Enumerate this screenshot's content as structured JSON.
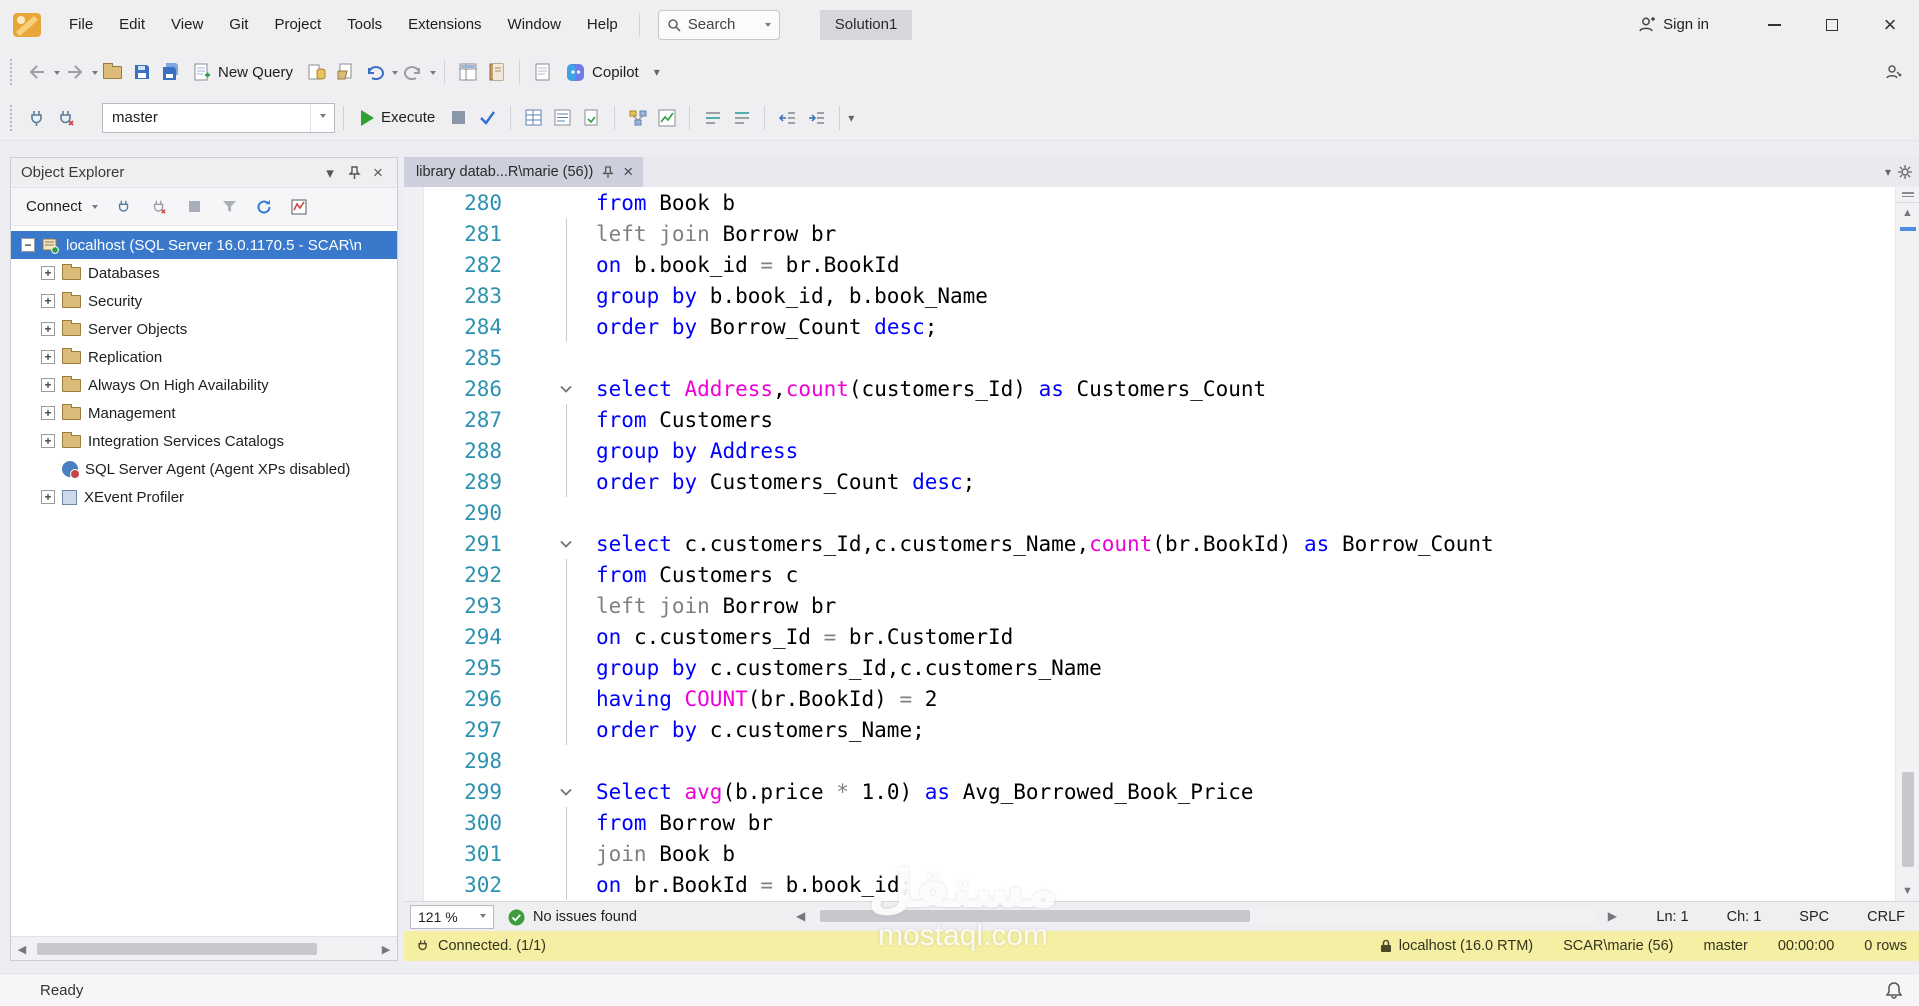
{
  "menu": {
    "items": [
      "File",
      "Edit",
      "View",
      "Git",
      "Project",
      "Tools",
      "Extensions",
      "Window",
      "Help"
    ],
    "search_label": "Search",
    "solution": "Solution1",
    "sign_in": "Sign in"
  },
  "toolbar": {
    "new_query": "New Query",
    "copilot": "Copilot"
  },
  "query_toolbar": {
    "database": "master",
    "execute": "Execute"
  },
  "object_explorer": {
    "title": "Object Explorer",
    "connect": "Connect",
    "root": "localhost (SQL Server 16.0.1170.5 - SCAR\\n",
    "items": [
      {
        "label": "Databases",
        "icon": "folder",
        "expand": true
      },
      {
        "label": "Security",
        "icon": "folder",
        "expand": true
      },
      {
        "label": "Server Objects",
        "icon": "folder",
        "expand": true
      },
      {
        "label": "Replication",
        "icon": "folder",
        "expand": true
      },
      {
        "label": "Always On High Availability",
        "icon": "folder",
        "expand": true
      },
      {
        "label": "Management",
        "icon": "folder",
        "expand": true
      },
      {
        "label": "Integration Services Catalogs",
        "icon": "folder",
        "expand": true
      },
      {
        "label": "SQL Server Agent (Agent XPs disabled)",
        "icon": "agent",
        "expand": false
      },
      {
        "label": "XEvent Profiler",
        "icon": "xevent",
        "expand": true
      }
    ]
  },
  "editor": {
    "tab_title": "library datab...R\\marie (56))",
    "zoom": "121 %",
    "issues": "No issues found",
    "ln": "Ln: 1",
    "ch": "Ch: 1",
    "spc": "SPC",
    "eol": "CRLF",
    "code": [
      {
        "n": "280",
        "seg": [
          [
            "k",
            "from"
          ],
          [
            "t",
            " Book b"
          ]
        ]
      },
      {
        "n": "281",
        "g": 1,
        "seg": [
          [
            "o",
            "left join"
          ],
          [
            "t",
            " Borrow br"
          ]
        ]
      },
      {
        "n": "282",
        "g": 1,
        "seg": [
          [
            "k",
            "on"
          ],
          [
            "t",
            " b.book_id "
          ],
          [
            "o",
            "="
          ],
          [
            "t",
            " br.BookId"
          ]
        ]
      },
      {
        "n": "283",
        "g": 1,
        "seg": [
          [
            "k",
            "group by"
          ],
          [
            "t",
            " b.book_id, b.book_Name"
          ]
        ]
      },
      {
        "n": "284",
        "g": 1,
        "seg": [
          [
            "k",
            "order by"
          ],
          [
            "t",
            " Borrow_Count "
          ],
          [
            "k",
            "desc"
          ],
          [
            "t",
            ";"
          ]
        ]
      },
      {
        "n": "285",
        "seg": []
      },
      {
        "n": "286",
        "fold": 1,
        "seg": [
          [
            "k",
            "select"
          ],
          [
            "t",
            " "
          ],
          [
            "f",
            "Address"
          ],
          [
            "t",
            ","
          ],
          [
            "f",
            "count"
          ],
          [
            "t",
            "(customers_Id) "
          ],
          [
            "k",
            "as"
          ],
          [
            "t",
            " Customers_Count"
          ]
        ]
      },
      {
        "n": "287",
        "g": 1,
        "seg": [
          [
            "k",
            "from"
          ],
          [
            "t",
            " Customers"
          ]
        ]
      },
      {
        "n": "288",
        "g": 1,
        "seg": [
          [
            "k",
            "group by"
          ],
          [
            "t",
            " "
          ],
          [
            "k",
            "Address"
          ]
        ]
      },
      {
        "n": "289",
        "g": 1,
        "seg": [
          [
            "k",
            "order by"
          ],
          [
            "t",
            " Customers_Count "
          ],
          [
            "k",
            "desc"
          ],
          [
            "t",
            ";"
          ]
        ]
      },
      {
        "n": "290",
        "seg": []
      },
      {
        "n": "291",
        "fold": 1,
        "seg": [
          [
            "k",
            "select"
          ],
          [
            "t",
            " c.customers_Id,c.customers_Name,"
          ],
          [
            "f",
            "count"
          ],
          [
            "t",
            "(br.BookId) "
          ],
          [
            "k",
            "as"
          ],
          [
            "t",
            " Borrow_Count"
          ]
        ]
      },
      {
        "n": "292",
        "g": 1,
        "seg": [
          [
            "k",
            "from"
          ],
          [
            "t",
            " Customers c"
          ]
        ]
      },
      {
        "n": "293",
        "g": 1,
        "seg": [
          [
            "o",
            "left join"
          ],
          [
            "t",
            " Borrow br"
          ]
        ]
      },
      {
        "n": "294",
        "g": 1,
        "seg": [
          [
            "k",
            "on"
          ],
          [
            "t",
            " c.customers_Id "
          ],
          [
            "o",
            "="
          ],
          [
            "t",
            " br.CustomerId"
          ]
        ]
      },
      {
        "n": "295",
        "g": 1,
        "seg": [
          [
            "k",
            "group by"
          ],
          [
            "t",
            " c.customers_Id,c.customers_Name"
          ]
        ]
      },
      {
        "n": "296",
        "g": 1,
        "seg": [
          [
            "k",
            "having"
          ],
          [
            "t",
            " "
          ],
          [
            "f",
            "COUNT"
          ],
          [
            "t",
            "(br.BookId) "
          ],
          [
            "o",
            "="
          ],
          [
            "t",
            " 2"
          ]
        ]
      },
      {
        "n": "297",
        "g": 1,
        "seg": [
          [
            "k",
            "order by"
          ],
          [
            "t",
            " c.customers_Name;"
          ]
        ]
      },
      {
        "n": "298",
        "seg": []
      },
      {
        "n": "299",
        "fold": 1,
        "seg": [
          [
            "k",
            "Select"
          ],
          [
            "t",
            " "
          ],
          [
            "f",
            "avg"
          ],
          [
            "t",
            "(b.price "
          ],
          [
            "o",
            "*"
          ],
          [
            "t",
            " 1.0) "
          ],
          [
            "k",
            "as"
          ],
          [
            "t",
            " Avg_Borrowed_Book_Price"
          ]
        ]
      },
      {
        "n": "300",
        "g": 1,
        "seg": [
          [
            "k",
            "from"
          ],
          [
            "t",
            " Borrow br"
          ]
        ]
      },
      {
        "n": "301",
        "g": 1,
        "seg": [
          [
            "o",
            "join"
          ],
          [
            "t",
            " Book b"
          ]
        ]
      },
      {
        "n": "302",
        "g": 1,
        "seg": [
          [
            "k",
            "on"
          ],
          [
            "t",
            " br.BookId "
          ],
          [
            "o",
            "="
          ],
          [
            "t",
            " b.book_id;"
          ]
        ]
      }
    ]
  },
  "connection_bar": {
    "status": "Connected. (1/1)",
    "server": "localhost (16.0 RTM)",
    "user": "SCAR\\marie (56)",
    "database": "master",
    "time": "00:00:00",
    "rows": "0 rows"
  },
  "statusbar": {
    "ready": "Ready"
  },
  "watermark": {
    "line1": "مستقل",
    "line2": "mostaql.com"
  },
  "colors": {
    "keyword": "#0000FF",
    "function": "#F000D8",
    "operator": "#808080",
    "selection": "#3A78CC",
    "connection_bar": "#F5EFA3"
  }
}
